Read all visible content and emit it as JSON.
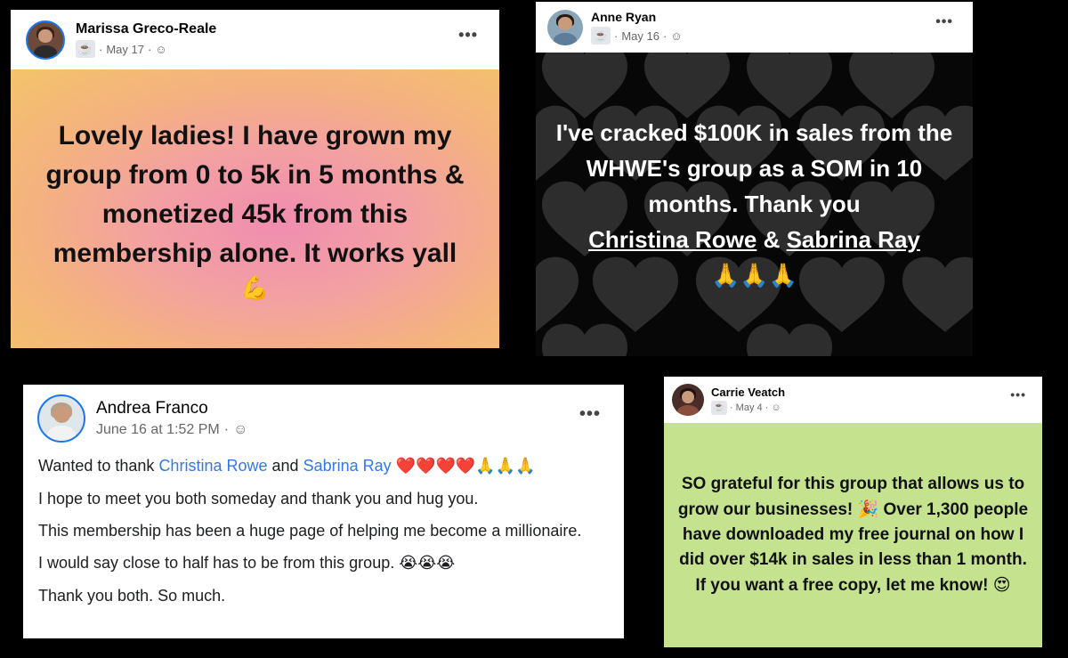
{
  "posts": [
    {
      "author": "Marissa Greco-Reale",
      "date": "May 17",
      "meta_sep": "·",
      "cup": "☕",
      "globe": "☺",
      "more": "•••",
      "text": "Lovely ladies! I have grown my group from 0 to 5k in 5 months & monetized 45k from this membership alone. It works yall",
      "emoji": "💪",
      "background": "pink-orange gradient"
    },
    {
      "author": "Anne Ryan",
      "date": "May 16",
      "meta_sep": "·",
      "cup": "☕",
      "globe": "☺",
      "more": "•••",
      "text_1": "I've cracked $100K in sales from the WHWE's group as a SOM in 10 months. Thank you",
      "mention_1": "Christina Rowe",
      "amp": "&",
      "mention_2": "Sabrina Ray",
      "emoji": "🙏🙏🙏",
      "background": "black hearts pattern"
    },
    {
      "author": "Andrea Franco",
      "date": "June 16 at 1:52 PM",
      "meta_sep": "·",
      "globe": "☺",
      "more": "•••",
      "line1_prefix": "Wanted to thank",
      "line1_mention1": "Christina Rowe",
      "line1_and": "and",
      "line1_mention2": "Sabrina Ray",
      "line1_emoji": "❤️❤️❤️❤️🙏🙏🙏",
      "line2": "I hope to meet you both someday and thank you and hug you.",
      "line3": "This membership has been a huge page of helping me become a millionaire.",
      "line4": "I would say close to half has to be from this group.",
      "line4_emoji": "😭😭😭",
      "line5": "Thank you both. So much."
    },
    {
      "author": "Carrie Veatch",
      "date": "May 4",
      "meta_sep": "·",
      "cup": "☕",
      "globe": "☺",
      "more": "•••",
      "text_1": "SO grateful for this group that allows us to grow our businesses!",
      "emoji_1": "🎉",
      "text_2": "Over 1,300 people have downloaded my free journal on how I did over $14k in sales in less than 1 month. If you want a free copy, let me know!",
      "emoji_2": "😍",
      "background": "light green"
    }
  ],
  "colors": {
    "facebook_blue": "#1877f2",
    "link_blue": "#3578e5",
    "green_bg": "#c5e38f",
    "black_bg": "#070707"
  }
}
